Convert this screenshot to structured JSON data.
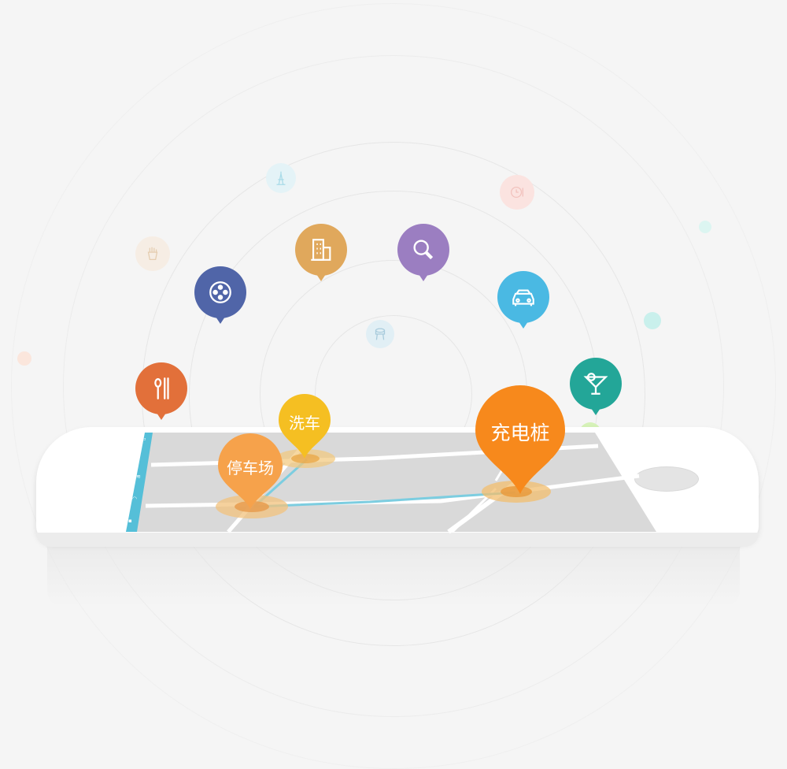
{
  "labels": {
    "parking": "停车场",
    "carwash": "洗车",
    "charging": "充电桩"
  },
  "icons": [
    "utensils-icon",
    "film-reel-icon",
    "building-icon",
    "search-magnifier-icon",
    "car-icon",
    "cocktail-icon",
    "fries-icon",
    "tower-icon",
    "water-tower-icon",
    "clock-icon"
  ],
  "colors": {
    "utensils": "#e2703a",
    "film": "#5065a8",
    "building": "#e0a85c",
    "search": "#9b7ec1",
    "car": "#4ab9e3",
    "cocktail": "#23a698",
    "parking": "#f6a24b",
    "carwash": "#f5bf22",
    "charging": "#f7891c",
    "route": "#7ccde0",
    "map": "#d9d9d9",
    "sidebar": "#55bfd8"
  }
}
